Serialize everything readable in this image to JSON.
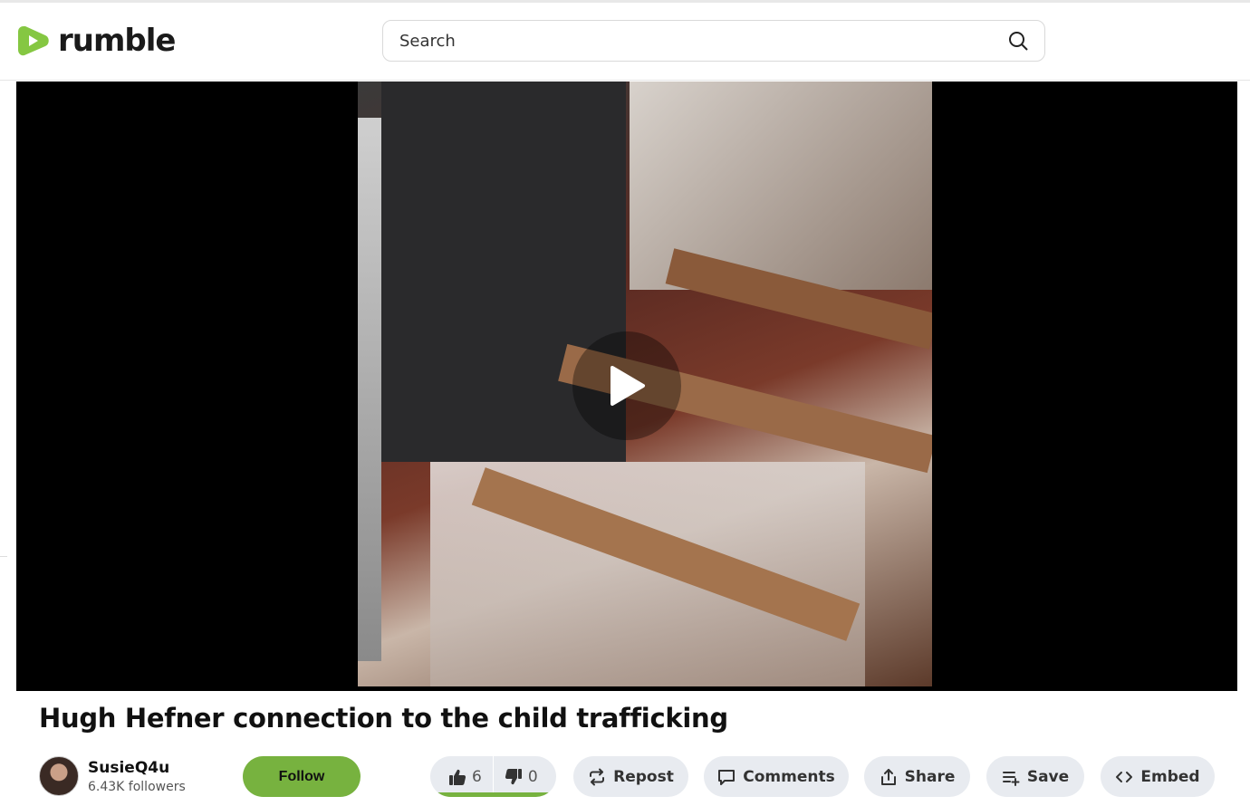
{
  "header": {
    "logo_text": "rumble",
    "search_placeholder": "Search",
    "brand_color": "#85c742"
  },
  "video": {
    "title": "Hugh Hefner connection to the child trafficking"
  },
  "channel": {
    "name": "SusieQ4u",
    "followers": "6.43K followers",
    "follow_label": "Follow"
  },
  "actions": {
    "likes": "6",
    "dislikes": "0",
    "like_ratio": 1.0,
    "repost_label": "Repost",
    "comments_label": "Comments",
    "share_label": "Share",
    "save_label": "Save",
    "embed_label": "Embed"
  },
  "icons": [
    "rumble-logo-icon",
    "search-icon",
    "play-icon",
    "thumbs-up-icon",
    "thumbs-down-icon",
    "repost-icon",
    "comment-icon",
    "share-icon",
    "save-playlist-icon",
    "embed-code-icon"
  ]
}
